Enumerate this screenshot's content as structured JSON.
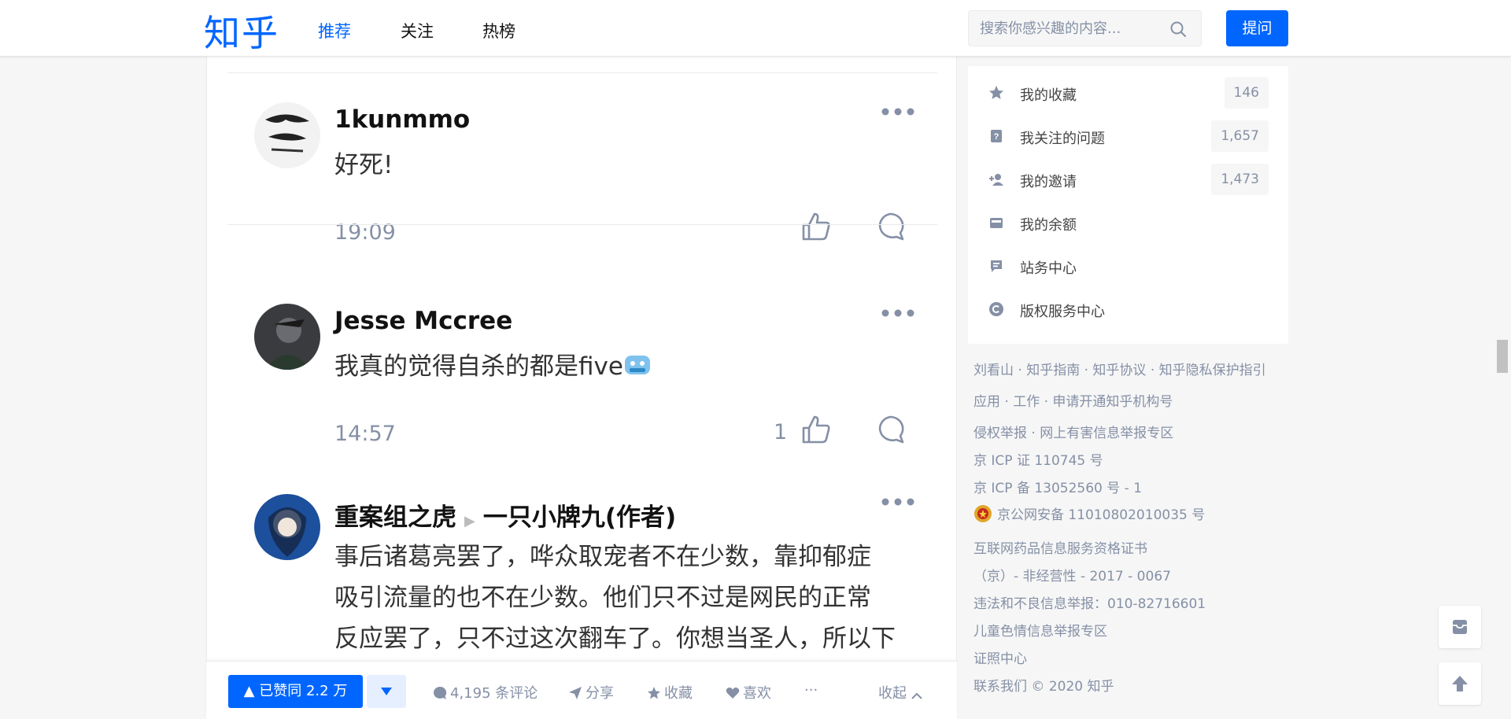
{
  "header": {
    "logo": "知乎",
    "nav": [
      "推荐",
      "关注",
      "热榜"
    ],
    "search_placeholder": "搜索你感兴趣的内容...",
    "ask_label": "提问"
  },
  "comments": [
    {
      "author": "1kunmmo",
      "text": "好死!",
      "time": "19:09",
      "likes": ""
    },
    {
      "author": "Jesse Mccree",
      "text": "我真的觉得自杀的都是five",
      "time": "14:57",
      "likes": "1"
    },
    {
      "author": "重案组之虎",
      "reply_to": "一只小牌九(作者)",
      "lines": [
        "事后诸葛亮罢了，哗众取宠者不在少数，靠抑郁症",
        "吸引流量的也不在少数。他们只不过是网民的正常",
        "反应罢了，只不过这次翻车了。你想当圣人，所以下"
      ]
    }
  ],
  "actionbar": {
    "vote_label": "已赞同 2.2 万",
    "comments_label": "4,195 条评论",
    "share_label": "分享",
    "collect_label": "收藏",
    "like_label": "喜欢",
    "more_label": "···",
    "collapse_label": "收起"
  },
  "sidebar": {
    "items": [
      {
        "label": "我的收藏",
        "count": "146",
        "icon": "star-icon"
      },
      {
        "label": "我关注的问题",
        "count": "1,657",
        "icon": "question-icon"
      },
      {
        "label": "我的邀请",
        "count": "1,473",
        "icon": "invite-icon"
      },
      {
        "label": "我的余额",
        "count": "",
        "icon": "wallet-icon"
      },
      {
        "label": "站务中心",
        "count": "",
        "icon": "notice-icon"
      },
      {
        "label": "版权服务中心",
        "count": "",
        "icon": "copyright-icon"
      }
    ]
  },
  "footer": {
    "line1": "刘看山 · 知乎指南 · 知乎协议 · 知乎隐私保护指引",
    "line2": "应用 · 工作 · 申请开通知乎机构号",
    "line3": "侵权举报 · 网上有害信息举报专区",
    "line4": "京 ICP 证 110745 号",
    "line5": "京 ICP 备 13052560 号 - 1",
    "line6": "京公网安备 11010802010035 号",
    "line7": "互联网药品信息服务资格证书",
    "line8": "（京）- 非经营性 - 2017 - 0067",
    "line9": "违法和不良信息举报：010-82716601",
    "line10": "儿童色情信息举报专区",
    "line11": "证照中心",
    "line12": "联系我们 © 2020 知乎"
  },
  "colors": {
    "brand": "#0066ff",
    "muted": "#8590a6"
  }
}
